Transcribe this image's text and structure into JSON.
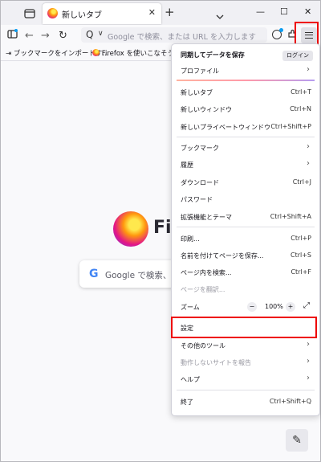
{
  "tab": {
    "title": "新しいタブ",
    "close": "✕"
  },
  "tabbar": {
    "new_tab": "+",
    "list_all": "⌄",
    "minimize": "—",
    "maximize": "☐",
    "close": "✕"
  },
  "navbar": {
    "back": "←",
    "forward": "→",
    "reload": "↻",
    "search_engine_icon": "Q",
    "engine_caret": "∨",
    "url_placeholder": "Google で検索、または URL を入力します"
  },
  "bookmarks": {
    "import": "ブックマークをインポートす...",
    "getting_started": "Firefox を使いこなそう"
  },
  "newtab_page": {
    "brand": "Firefox",
    "search_g": "G",
    "search_placeholder": "Google で検索、ま"
  },
  "menu": {
    "sync": "同期してデータを保存",
    "login": "ログイン",
    "profile": "プロファイル",
    "new_tab": "新しいタブ",
    "new_tab_sc": "Ctrl+T",
    "new_window": "新しいウィンドウ",
    "new_window_sc": "Ctrl+N",
    "new_private": "新しいプライベートウィンドウ",
    "new_private_sc": "Ctrl+Shift+P",
    "bookmarks": "ブックマーク",
    "history": "履歴",
    "downloads": "ダウンロード",
    "downloads_sc": "Ctrl+J",
    "passwords": "パスワード",
    "addons": "拡張機能とテーマ",
    "addons_sc": "Ctrl+Shift+A",
    "print": "印刷...",
    "print_sc": "Ctrl+P",
    "save_as": "名前を付けてページを保存...",
    "save_as_sc": "Ctrl+S",
    "find": "ページ内を検索...",
    "find_sc": "Ctrl+F",
    "translate": "ページを翻訳...",
    "zoom": "ズーム",
    "zoom_out": "−",
    "zoom_level": "100%",
    "zoom_in": "+",
    "fullscreen": "⤢",
    "settings": "設定",
    "more_tools": "その他のツール",
    "report_site": "動作しないサイトを報告",
    "help": "ヘルプ",
    "quit": "終了",
    "quit_sc": "Ctrl+Shift+Q"
  },
  "colors": {
    "highlight": "#ee0000",
    "accent": "#0b9cf1"
  }
}
